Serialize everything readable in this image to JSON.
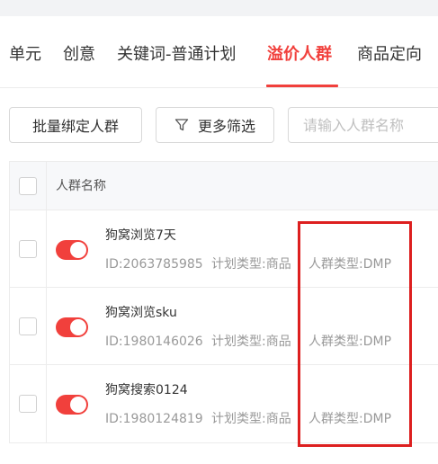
{
  "tabs": [
    {
      "label": "单元",
      "active": false
    },
    {
      "label": "创意",
      "active": false
    },
    {
      "label": "关键词-普通计划",
      "active": false
    },
    {
      "label": "溢价人群",
      "active": true
    },
    {
      "label": "商品定向",
      "active": false
    }
  ],
  "toolbar": {
    "bind_label": "批量绑定人群",
    "filter_label": "更多筛选",
    "search_placeholder": "请输入人群名称"
  },
  "table": {
    "header": "人群名称",
    "rows": [
      {
        "name": "狗窝浏览7天",
        "id": "ID:2063785985",
        "plan_type": "计划类型:商品",
        "crowd_type": "人群类型:DMP",
        "enabled": true
      },
      {
        "name": "狗窝浏览sku",
        "id": "ID:1980146026",
        "plan_type": "计划类型:商品",
        "crowd_type": "人群类型:DMP",
        "enabled": true
      },
      {
        "name": "狗窝搜索0124",
        "id": "ID:1980124819",
        "plan_type": "计划类型:商品",
        "crowd_type": "人群类型:DMP",
        "enabled": true
      }
    ]
  },
  "colors": {
    "accent": "#f1403c",
    "highlight_box": "#dd1f1f"
  },
  "icons": {
    "filter": "filter-icon"
  }
}
